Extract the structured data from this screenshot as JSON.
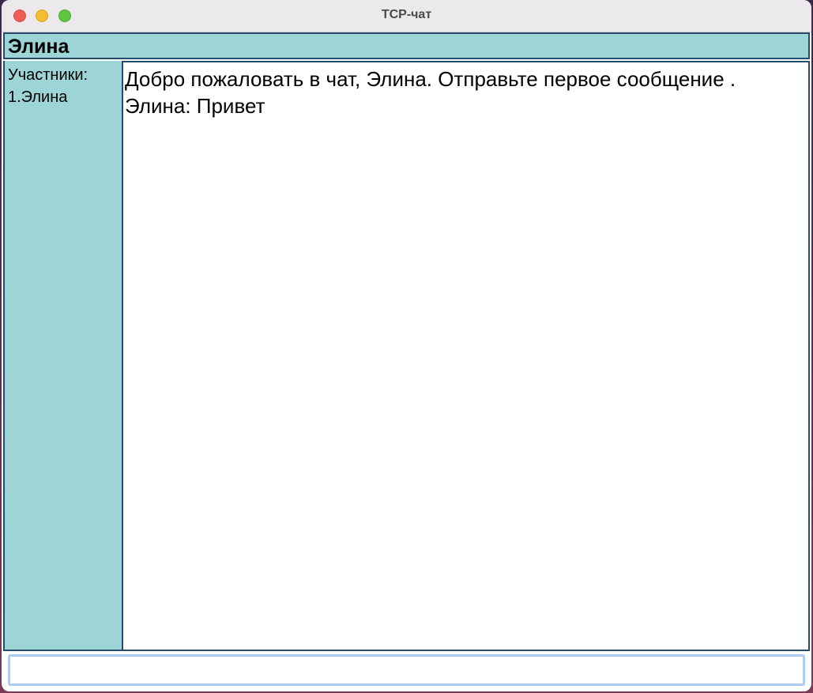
{
  "window": {
    "title": "TCP-чат"
  },
  "header": {
    "username": "Элина"
  },
  "sidebar": {
    "title": "Участники:",
    "participants": [
      "1.Элина"
    ]
  },
  "chat": {
    "messages": [
      "Добро пожаловать в чат, Элина. Отправьте первое сообщение .",
      "Элина: Привет"
    ]
  },
  "input": {
    "value": "",
    "placeholder": ""
  },
  "colors": {
    "panel": "#9dd4d6",
    "border": "#294b6a",
    "input_focus": "#aecdf4"
  }
}
